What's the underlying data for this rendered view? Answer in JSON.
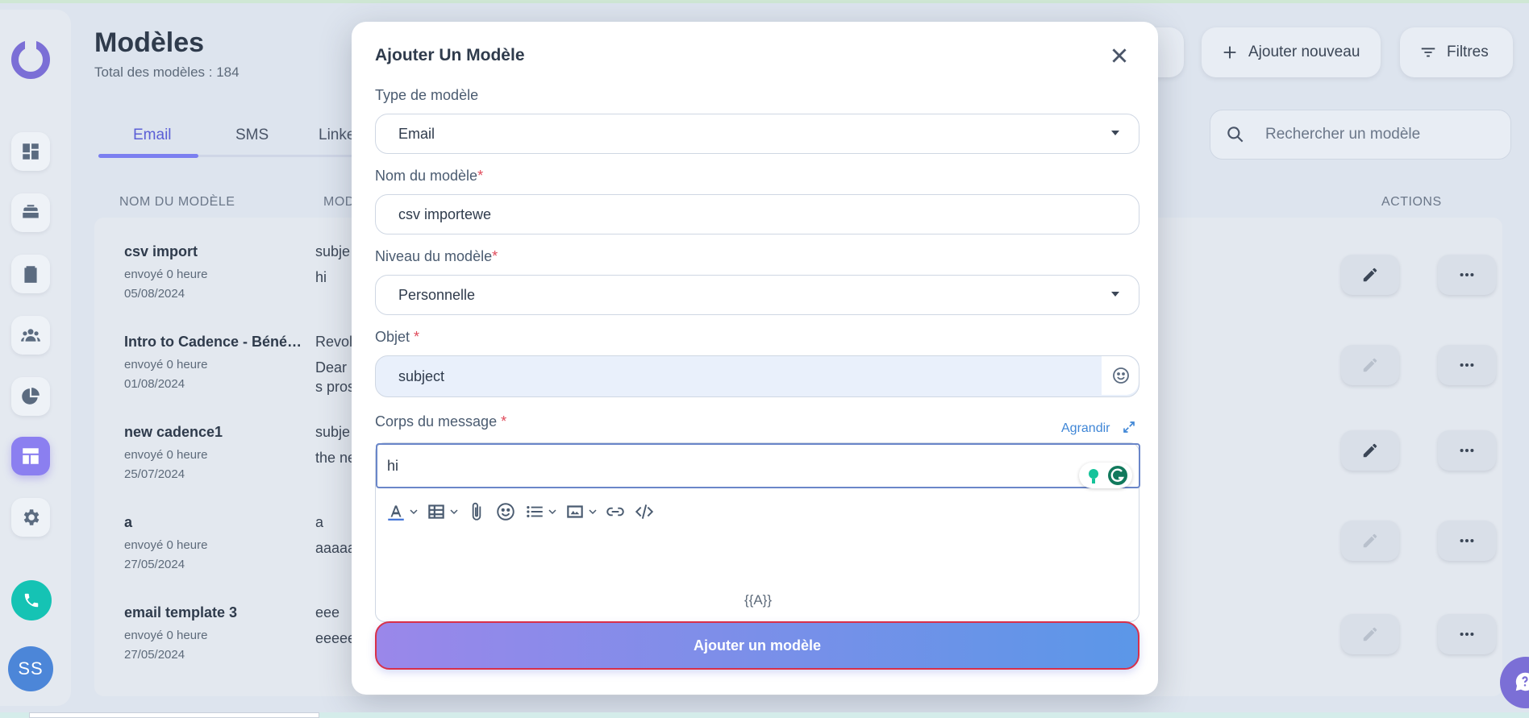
{
  "page": {
    "title": "Modèles",
    "subtitle": "Total des modèles : 184"
  },
  "tabs": [
    {
      "label": "Email",
      "active": true
    },
    {
      "label": "SMS",
      "active": false
    },
    {
      "label": "Linke",
      "active": false
    }
  ],
  "header_buttons": {
    "add_new": "Ajouter nouveau",
    "filters": "Filtres"
  },
  "search": {
    "placeholder": "Rechercher un modèle"
  },
  "table": {
    "columns": [
      "NOM DU MODÈLE",
      "MOD",
      "ACTIONS"
    ],
    "rows": [
      {
        "name": "csv import",
        "sent": "envoyé 0 heure",
        "date": "05/08/2024",
        "line1": "subje",
        "line2": "hi",
        "line3": "",
        "edit_enabled": true
      },
      {
        "name": "Intro to Cadence - Béné…",
        "sent": "envoyé 0 heure",
        "date": "01/08/2024",
        "line1": "Revol",
        "line2": "Dear",
        "line3": "s pros",
        "edit_enabled": false
      },
      {
        "name": "new cadence1",
        "sent": "envoyé 0 heure",
        "date": "25/07/2024",
        "line1": "subje",
        "line2": "the ne",
        "line3": "",
        "edit_enabled": true
      },
      {
        "name": "a",
        "sent": "envoyé 0 heure",
        "date": "27/05/2024",
        "line1": "a",
        "line2": "aaaaa",
        "line3": "",
        "edit_enabled": false
      },
      {
        "name": "email template 3",
        "sent": "envoyé 0 heure",
        "date": "27/05/2024",
        "line1": "eee",
        "line2": "eeeee",
        "line3": "",
        "edit_enabled": false
      }
    ]
  },
  "sidebar": {
    "avatar_initials": "SS"
  },
  "modal": {
    "title": "Ajouter Un Modèle",
    "type_label": "Type de modèle",
    "type_value": "Email",
    "name_label": "Nom du modèle",
    "name_value": "csv importewe",
    "level_label": "Niveau du modèle",
    "level_value": "Personnelle",
    "subject_label": "Objet",
    "subject_value": "subject",
    "body_label": "Corps du message",
    "expand_label": "Agrandir",
    "body_value": "hi",
    "merge_tag": "{{A}}",
    "submit_label": "Ajouter un modèle",
    "required_mark": "*"
  },
  "colors": {
    "accent": "#7b7ff0",
    "required": "#e04a5a",
    "link": "#3f86d6",
    "submit_start": "#9a87ea",
    "submit_end": "#5b97e8"
  }
}
